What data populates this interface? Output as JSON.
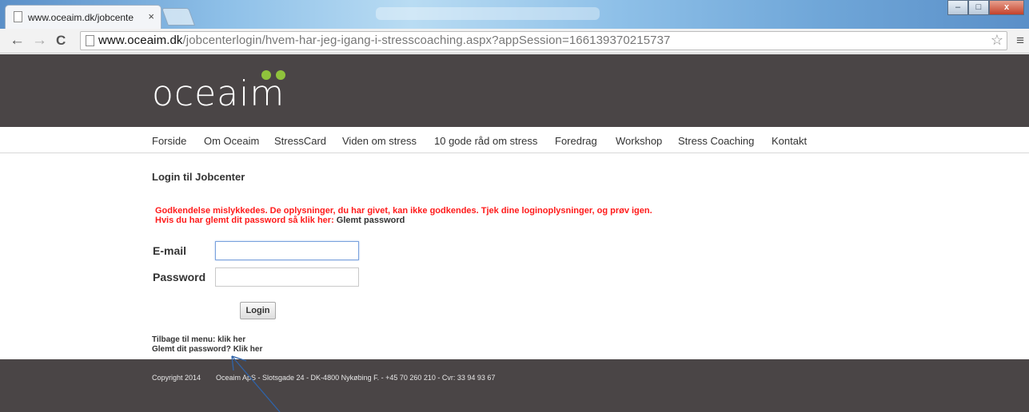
{
  "browser": {
    "tab_title": "www.oceaim.dk/jobcente",
    "tab_close": "×",
    "url_host": "www.oceaim.dk",
    "url_path": "/jobcenterlogin/hvem-har-jeg-igang-i-stresscoaching.aspx?appSession=166139370215737",
    "back": "←",
    "forward": "→",
    "reload": "C",
    "star": "☆",
    "menu": "≡",
    "win_min": "–",
    "win_max": "□",
    "win_close": "x"
  },
  "site": {
    "logo_text": "oceaim",
    "accent_color": "#8fc33c",
    "header_color": "#4a4546"
  },
  "nav": {
    "items": [
      "Forside",
      "Om Oceaim",
      "StressCard",
      "Viden om stress",
      "10 gode råd om stress",
      "Foredrag",
      "Workshop",
      "Stress Coaching",
      "Kontakt"
    ]
  },
  "login": {
    "title": "Login til Jobcenter",
    "error_line1": "Godkendelse mislykkedes. De oplysninger, du har givet, kan ikke godkendes. Tjek dine loginoplysninger, og prøv igen.",
    "error_line2_prefix": "Hvis du har glemt dit password så klik her:",
    "error_line2_link": "Glemt password",
    "email_label": "E-mail",
    "email_value": "",
    "password_label": "Password",
    "password_value": "",
    "button_label": "Login",
    "back_prefix": "Tilbage til menu:",
    "back_link": "klik her",
    "forgot_prefix": "Glemt dit password?",
    "forgot_link": "Klik her"
  },
  "footer": {
    "copyright": "Copyright 2014",
    "company": "Oceaim ApS - Slotsgade 24 - DK-4800 Nykøbing F. - +45 70 260 210 - Cvr: 33 94 93 67"
  }
}
